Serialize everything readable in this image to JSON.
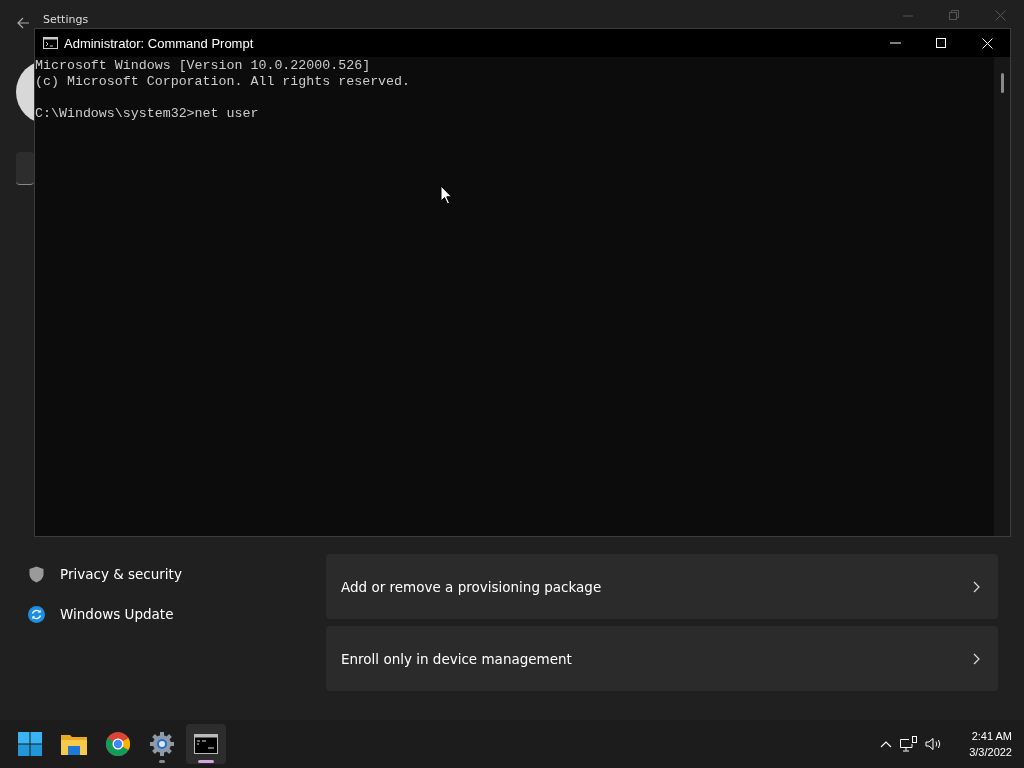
{
  "settings_window": {
    "title": "Settings",
    "sidebar": {
      "items": [
        {
          "kind": "shield",
          "label": "Privacy & security"
        },
        {
          "kind": "update",
          "label": "Windows Update"
        }
      ]
    },
    "cards": [
      {
        "label": "Add or remove a provisioning package"
      },
      {
        "label": "Enroll only in device management"
      }
    ]
  },
  "command_prompt": {
    "title": "Administrator: Command Prompt",
    "lines": [
      "Microsoft Windows [Version 10.0.22000.526]",
      "(c) Microsoft Corporation. All rights reserved."
    ],
    "prompt": "C:\\Windows\\system32>net user"
  },
  "taskbar": {
    "apps": [
      {
        "kind": "start",
        "running": false,
        "active": false
      },
      {
        "kind": "folder",
        "running": false,
        "active": false
      },
      {
        "kind": "browser",
        "running": false,
        "active": false
      },
      {
        "kind": "settings",
        "running": true,
        "active": false
      },
      {
        "kind": "terminal",
        "running": true,
        "active": true
      }
    ],
    "clock": {
      "time": "2:41 AM",
      "date": "3/3/2022"
    }
  }
}
